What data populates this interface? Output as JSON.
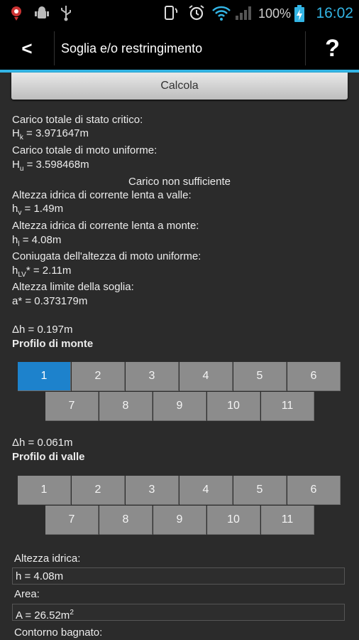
{
  "status_bar": {
    "icons": [
      "notification-icon",
      "android-debug-icon",
      "usb-icon",
      "phone-rotate-icon",
      "alarm-icon",
      "wifi-icon",
      "signal-icon",
      "battery-charging-icon"
    ],
    "battery": "100%",
    "time": "16:02"
  },
  "action_bar": {
    "back": "<",
    "title": "Soglia e/o restringimento",
    "help": "?"
  },
  "calcola_label": "Calcola",
  "results": {
    "hk_label": "Carico totale di stato critico:",
    "hk_sym": "H",
    "hk_sub": "k",
    "hk_val": " = 3.971647m",
    "hu_label": "Carico totale di moto uniforme:",
    "hu_sym": "H",
    "hu_sub": "u",
    "hu_val": " = 3.598468m",
    "warning": "Carico non sufficiente",
    "hv_label": "Altezza idrica di corrente lenta a valle:",
    "hv_sym": "h",
    "hv_sub": "v",
    "hv_val": " = 1.49m",
    "hl_label": "Altezza idrica di corrente lenta a monte:",
    "hl_sym": "h",
    "hl_sub": "l",
    "hl_val": " = 4.08m",
    "hlv_label": "Coniugata dell'altezza di moto uniforme:",
    "hlv_sym": "h",
    "hlv_sub": "LV",
    "hlv_val": "* = 2.11m",
    "a_label": "Altezza limite della soglia:",
    "a_val": "a* = 0.373179m"
  },
  "monte": {
    "dh": "Δh = 0.197m",
    "title": "Profilo di monte",
    "row1": [
      "1",
      "2",
      "3",
      "4",
      "5",
      "6"
    ],
    "row2": [
      "7",
      "8",
      "9",
      "10",
      "11"
    ],
    "selected": "1"
  },
  "valle": {
    "dh": "Δh = 0.061m",
    "title": "Profilo di valle",
    "row1": [
      "1",
      "2",
      "3",
      "4",
      "5",
      "6"
    ],
    "row2": [
      "7",
      "8",
      "9",
      "10",
      "11"
    ]
  },
  "details": {
    "h_label": "Altezza idrica:",
    "h_value": "h = 4.08m",
    "area_label": "Area:",
    "area_value": "A = 26.52m",
    "area_exp": "2",
    "contorno_label": "Contorno bagnato:"
  }
}
